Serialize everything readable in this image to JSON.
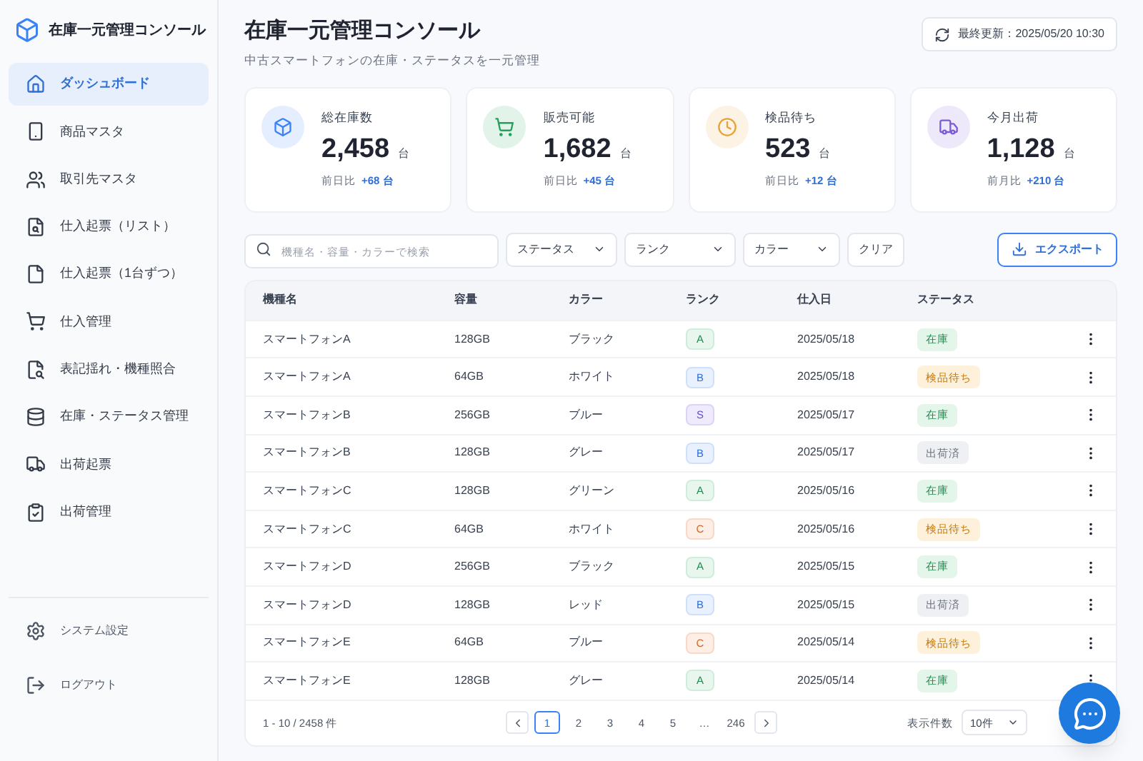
{
  "sidebar": {
    "app_title": "在庫一元管理コンソール",
    "items": [
      {
        "label": "ダッシュボード",
        "selected": true
      },
      {
        "label": "商品マスタ",
        "selected": false
      },
      {
        "label": "取引先マスタ",
        "selected": false
      },
      {
        "label": "仕入起票（リスト）",
        "selected": false
      },
      {
        "label": "仕入起票（1台ずつ）",
        "selected": false
      },
      {
        "label": "仕入管理",
        "selected": false
      },
      {
        "label": "表記揺れ・機種照合",
        "selected": false
      },
      {
        "label": "在庫・ステータス管理",
        "selected": false
      },
      {
        "label": "出荷起票",
        "selected": false
      },
      {
        "label": "出荷管理",
        "selected": false
      }
    ],
    "footer_items": [
      {
        "label": "システム設定"
      },
      {
        "label": "ログアウト"
      }
    ]
  },
  "header": {
    "title": "在庫一元管理コンソール",
    "subtitle": "中古スマートフォンの在庫・ステータスを一元管理",
    "last_updated": "最終更新：2025/05/20 10:30"
  },
  "stats": [
    {
      "label": "総在庫数",
      "value": "2,458",
      "unit": "台",
      "compare_label": "前日比",
      "delta": "+68 台",
      "color": "#3b82f6"
    },
    {
      "label": "販売可能",
      "value": "1,682",
      "unit": "台",
      "compare_label": "前日比",
      "delta": "+45 台",
      "color": "#22a35a"
    },
    {
      "label": "検品待ち",
      "value": "523",
      "unit": "台",
      "compare_label": "前日比",
      "delta": "+12 台",
      "color": "#e8a23a"
    },
    {
      "label": "今月出荷",
      "value": "1,128",
      "unit": "台",
      "compare_label": "前月比",
      "delta": "+210 台",
      "color": "#7c5cd6"
    }
  ],
  "toolbar": {
    "search": {
      "placeholder": "機種名・容量・カラーで検索"
    },
    "filters": [
      "ステータス",
      "ランク",
      "カラー"
    ],
    "clear": "クリア",
    "export": "エクスポート"
  },
  "table": {
    "columns": [
      "機種名",
      "容量",
      "カラー",
      "ランク",
      "仕入日",
      "ステータス"
    ],
    "rows": [
      {
        "model": "スマートフォンA",
        "capacity": "128GB",
        "color_name": "ブラック",
        "rank": {
          "label": "A",
          "kind": "a"
        },
        "date": "2025/05/18",
        "status": {
          "label": "在庫",
          "kind": "stock"
        }
      },
      {
        "model": "スマートフォンA",
        "capacity": "64GB",
        "color_name": "ホワイト",
        "rank": {
          "label": "B",
          "kind": "b"
        },
        "date": "2025/05/18",
        "status": {
          "label": "検品待ち",
          "kind": "pending"
        }
      },
      {
        "model": "スマートフォンB",
        "capacity": "256GB",
        "color_name": "ブルー",
        "rank": {
          "label": "S",
          "kind": "s"
        },
        "date": "2025/05/17",
        "status": {
          "label": "在庫",
          "kind": "stock"
        }
      },
      {
        "model": "スマートフォンB",
        "capacity": "128GB",
        "color_name": "グレー",
        "rank": {
          "label": "B",
          "kind": "b"
        },
        "date": "2025/05/17",
        "status": {
          "label": "出荷済",
          "kind": "shipped"
        }
      },
      {
        "model": "スマートフォンC",
        "capacity": "128GB",
        "color_name": "グリーン",
        "rank": {
          "label": "A",
          "kind": "a"
        },
        "date": "2025/05/16",
        "status": {
          "label": "在庫",
          "kind": "stock"
        }
      },
      {
        "model": "スマートフォンC",
        "capacity": "64GB",
        "color_name": "ホワイト",
        "rank": {
          "label": "C",
          "kind": "c"
        },
        "date": "2025/05/16",
        "status": {
          "label": "検品待ち",
          "kind": "pending"
        }
      },
      {
        "model": "スマートフォンD",
        "capacity": "256GB",
        "color_name": "ブラック",
        "rank": {
          "label": "A",
          "kind": "a"
        },
        "date": "2025/05/15",
        "status": {
          "label": "在庫",
          "kind": "stock"
        }
      },
      {
        "model": "スマートフォンD",
        "capacity": "128GB",
        "color_name": "レッド",
        "rank": {
          "label": "B",
          "kind": "b"
        },
        "date": "2025/05/15",
        "status": {
          "label": "出荷済",
          "kind": "shipped"
        }
      },
      {
        "model": "スマートフォンE",
        "capacity": "64GB",
        "color_name": "ブルー",
        "rank": {
          "label": "C",
          "kind": "c"
        },
        "date": "2025/05/14",
        "status": {
          "label": "検品待ち",
          "kind": "pending"
        }
      },
      {
        "model": "スマートフォンE",
        "capacity": "128GB",
        "color_name": "グレー",
        "rank": {
          "label": "A",
          "kind": "a"
        },
        "date": "2025/05/14",
        "status": {
          "label": "在庫",
          "kind": "stock"
        }
      }
    ]
  },
  "pagination": {
    "range": "1 - 10 / 2458 件",
    "pages": [
      {
        "label": "1",
        "selected": true
      },
      {
        "label": "2",
        "selected": false
      },
      {
        "label": "3",
        "selected": false
      },
      {
        "label": "4",
        "selected": false
      },
      {
        "label": "5",
        "selected": false
      },
      {
        "label": "…",
        "selected": false
      },
      {
        "label": "246",
        "selected": false
      }
    ],
    "page_size_label": "表示件数",
    "page_size": "10件"
  }
}
